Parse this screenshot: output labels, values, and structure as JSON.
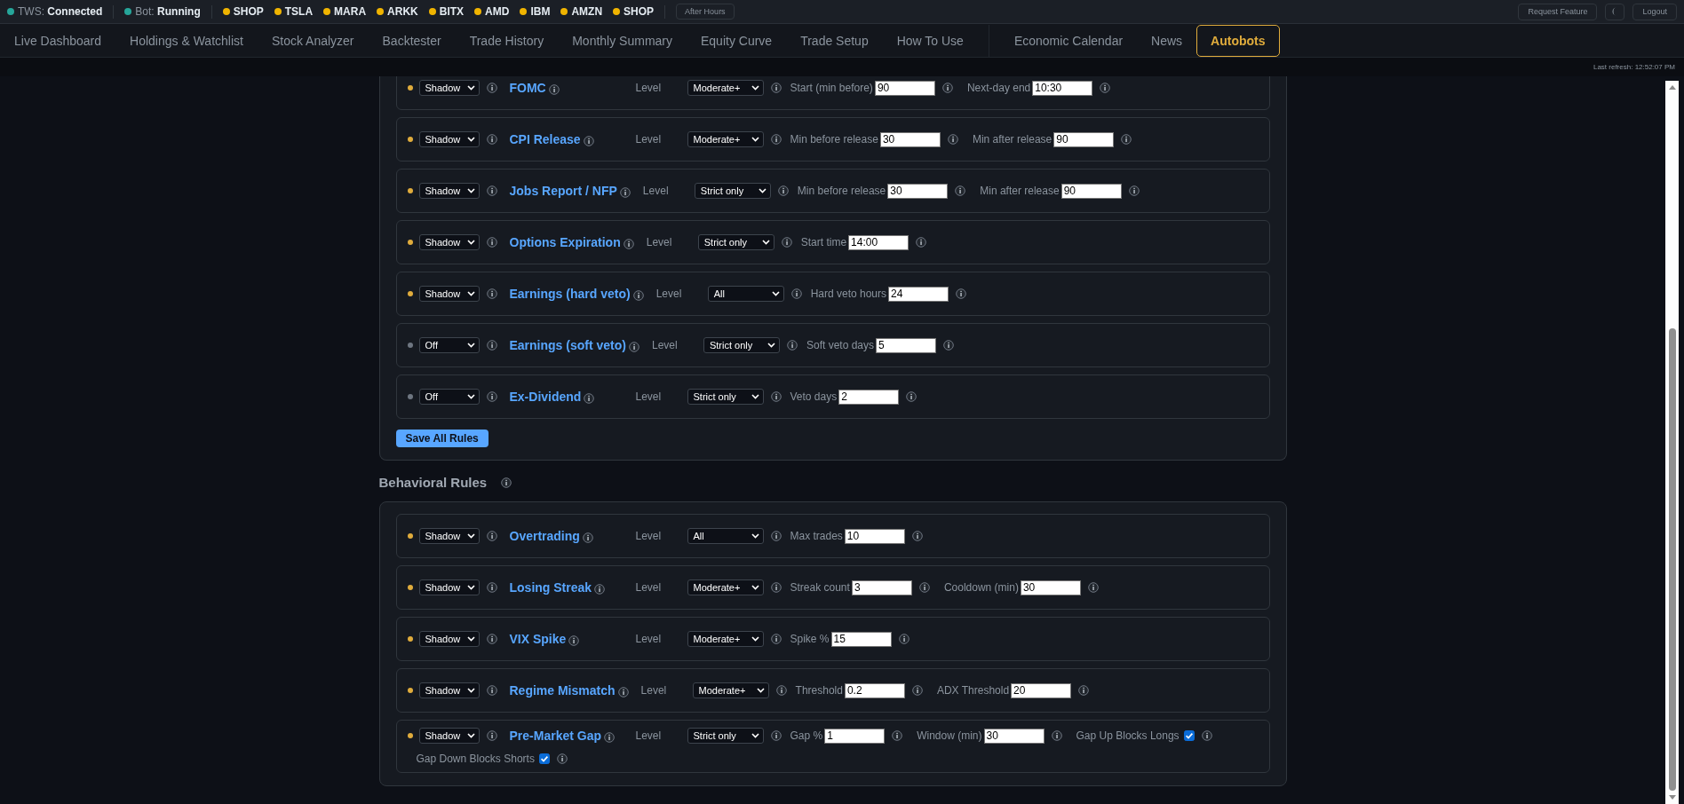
{
  "status_bar": {
    "tws": {
      "label": "TWS:",
      "value": "Connected",
      "color": "#26a69a"
    },
    "bot": {
      "label": "Bot:",
      "value": "Running",
      "color": "#26a69a"
    },
    "tickers": [
      {
        "symbol": "SHOP",
        "color": "#f0b400"
      },
      {
        "symbol": "TSLA",
        "color": "#f0b400"
      },
      {
        "symbol": "MARA",
        "color": "#f0b400"
      },
      {
        "symbol": "ARKK",
        "color": "#f0b400"
      },
      {
        "symbol": "BITX",
        "color": "#f0b400"
      },
      {
        "symbol": "AMD",
        "color": "#f0b400"
      },
      {
        "symbol": "IBM",
        "color": "#f0b400"
      },
      {
        "symbol": "AMZN",
        "color": "#f0b400"
      },
      {
        "symbol": "SHOP",
        "color": "#f0b400"
      }
    ],
    "market_badge": "After Hours",
    "buttons": [
      "Request Feature",
      "Logout"
    ]
  },
  "tab_groups": [
    [
      {
        "label": "Live Dashboard",
        "selected": false
      },
      {
        "label": "Holdings & Watchlist",
        "selected": false
      },
      {
        "label": "Stock Analyzer",
        "selected": false
      },
      {
        "label": "Backtester",
        "selected": false
      },
      {
        "label": "Trade History",
        "selected": false
      },
      {
        "label": "Monthly Summary",
        "selected": false
      },
      {
        "label": "Equity Curve",
        "selected": false
      },
      {
        "label": "Trade Setup",
        "selected": false
      },
      {
        "label": "How To Use",
        "selected": false
      }
    ],
    [
      {
        "label": "Economic Calendar",
        "selected": false
      },
      {
        "label": "News",
        "selected": false
      },
      {
        "label": "Autobots",
        "selected": true
      }
    ]
  ],
  "last_refresh": "Last refresh: 12:52:07 PM",
  "sections": [
    {
      "rules": [
        {
          "mode": "Shadow",
          "color": "#e0ac3c",
          "name": "FOMC",
          "level_label": "Level",
          "level": "Moderate+",
          "params": [
            {
              "kind": "input",
              "label": "Start (min before)",
              "value": "90"
            },
            {
              "kind": "input",
              "label": "Next-day end",
              "value": "10:30"
            }
          ]
        },
        {
          "mode": "Shadow",
          "color": "#e0ac3c",
          "name": "CPI Release",
          "level_label": "Level",
          "level": "Moderate+",
          "params": [
            {
              "kind": "input",
              "label": "Min before release",
              "value": "30"
            },
            {
              "kind": "input",
              "label": "Min after release",
              "value": "90"
            }
          ]
        },
        {
          "mode": "Shadow",
          "color": "#e0ac3c",
          "name": "Jobs Report / NFP",
          "level_label": "Level",
          "level": "Strict only",
          "params": [
            {
              "kind": "input",
              "label": "Min before release",
              "value": "30"
            },
            {
              "kind": "input",
              "label": "Min after release",
              "value": "90"
            }
          ]
        },
        {
          "mode": "Shadow",
          "color": "#e0ac3c",
          "name": "Options Expiration",
          "level_label": "Level",
          "level": "Strict only",
          "params": [
            {
              "kind": "input",
              "label": "Start time",
              "value": "14:00"
            }
          ]
        },
        {
          "mode": "Shadow",
          "color": "#e0ac3c",
          "name": "Earnings (hard veto)",
          "level_label": "Level",
          "level": "All",
          "params": [
            {
              "kind": "input",
              "label": "Hard veto hours",
              "value": "24"
            }
          ]
        },
        {
          "mode": "Off",
          "color": "#6e7681",
          "name": "Earnings (soft veto)",
          "level_label": "Level",
          "level": "Strict only",
          "params": [
            {
              "kind": "input",
              "label": "Soft veto days",
              "value": "5"
            }
          ]
        },
        {
          "mode": "Off",
          "color": "#6e7681",
          "name": "Ex-Dividend",
          "level_label": "Level",
          "level": "Strict only",
          "params": [
            {
              "kind": "input",
              "label": "Veto days",
              "value": "2"
            }
          ]
        }
      ],
      "save_button": "Save All Rules"
    },
    {
      "title": "Behavioral Rules",
      "rules": [
        {
          "mode": "Shadow",
          "color": "#e0ac3c",
          "name": "Overtrading",
          "level_label": "Level",
          "level": "All",
          "params": [
            {
              "kind": "input",
              "label": "Max trades",
              "value": "10"
            }
          ]
        },
        {
          "mode": "Shadow",
          "color": "#e0ac3c",
          "name": "Losing Streak",
          "level_label": "Level",
          "level": "Moderate+",
          "params": [
            {
              "kind": "input",
              "label": "Streak count",
              "value": "3"
            },
            {
              "kind": "input",
              "label": "Cooldown (min)",
              "value": "30"
            }
          ]
        },
        {
          "mode": "Shadow",
          "color": "#e0ac3c",
          "name": "VIX Spike",
          "level_label": "Level",
          "level": "Moderate+",
          "params": [
            {
              "kind": "input",
              "label": "Spike %",
              "value": "15"
            }
          ]
        },
        {
          "mode": "Shadow",
          "color": "#e0ac3c",
          "name": "Regime Mismatch",
          "level_label": "Level",
          "level": "Moderate+",
          "params": [
            {
              "kind": "input",
              "label": "Threshold",
              "value": "0.2"
            },
            {
              "kind": "input",
              "label": "ADX Threshold",
              "value": "20"
            }
          ]
        },
        {
          "mode": "Shadow",
          "color": "#e0ac3c",
          "name": "Pre-Market Gap",
          "level_label": "Level",
          "level": "Strict only",
          "params": [
            {
              "kind": "input",
              "label": "Gap %",
              "value": "1"
            },
            {
              "kind": "input",
              "label": "Window (min)",
              "value": "30"
            },
            {
              "kind": "checkbox",
              "label": "Gap Up Blocks Longs",
              "checked": true
            },
            {
              "kind": "checkbox",
              "label": "Gap Down Blocks Shorts",
              "checked": true
            }
          ]
        }
      ]
    }
  ]
}
